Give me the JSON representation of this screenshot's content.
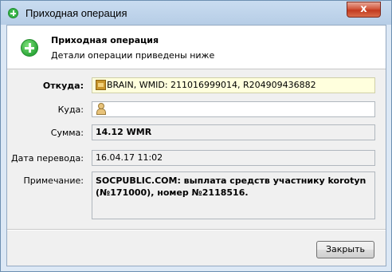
{
  "window": {
    "title": "Приходная операция",
    "close_symbol": "x"
  },
  "header": {
    "title": "Приходная операция",
    "subtitle": "Детали операции приведены ниже",
    "icon": "plus-circle-icon"
  },
  "form": {
    "from": {
      "label": "Откуда:",
      "value": "BRAIN, WMID: 211016999014, R204909436882",
      "icon": "wallet-icon"
    },
    "to": {
      "label": "Куда:",
      "value": "",
      "icon": "user-icon"
    },
    "amount": {
      "label": "Сумма:",
      "value": "14.12 WMR"
    },
    "date": {
      "label": "Дата перевода:",
      "value": "16.04.17 11:02"
    },
    "note": {
      "label": "Примечание:",
      "value": "SOCPUBLIC.COM: выплата средств участнику korotyn (№171000), номер №2118516."
    }
  },
  "footer": {
    "close_button": "Закрыть"
  },
  "colors": {
    "title_bar": "#c9dcf0",
    "close_button": "#c23a1f",
    "yellow_field": "#ffffdd",
    "panel_bg": "#f0f0f0"
  }
}
